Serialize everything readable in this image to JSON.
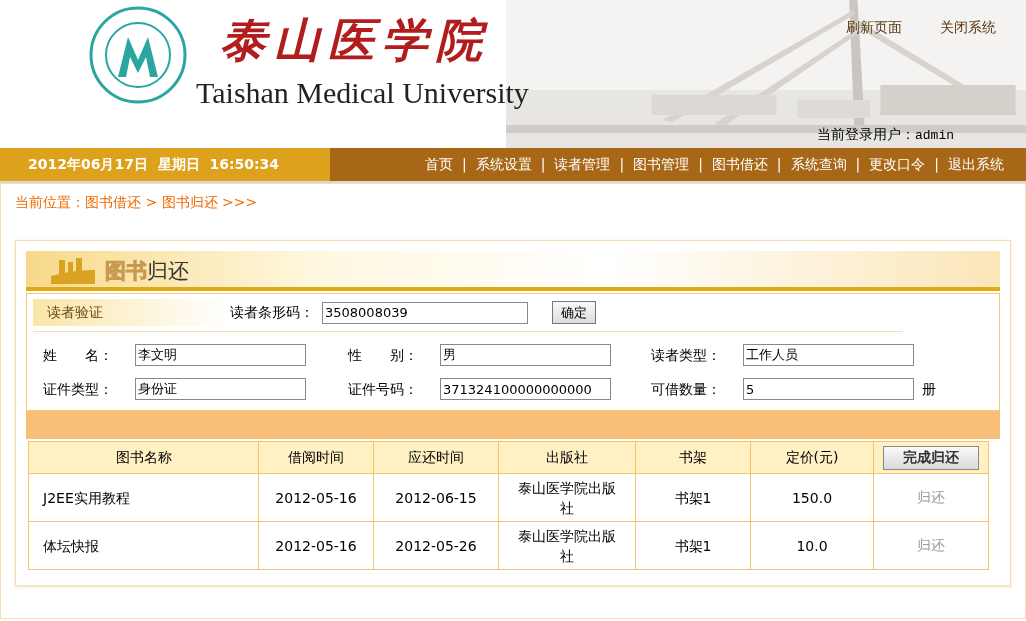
{
  "header": {
    "title": "泰山医学院",
    "subtitle": "Taishan Medical University",
    "links": [
      "刷新页面",
      "关闭系统"
    ],
    "user_label": "当前登录用户：",
    "user": "admin"
  },
  "nav": {
    "datetime": "2012年06月17日  星期日  16:50:34",
    "items": [
      "首页",
      "系统设置",
      "读者管理",
      "图书管理",
      "图书借还",
      "系统查询",
      "更改口令",
      "退出系统"
    ],
    "separator": "|"
  },
  "breadcrumb": "当前位置：图书借还 > 图书归还 >>>",
  "panel": {
    "title_parts": [
      "图书",
      "归还"
    ],
    "verify": {
      "label": "读者验证",
      "field_label": "读者条形码：",
      "value": "3508008039",
      "button": "确定"
    },
    "fields": [
      {
        "label": "姓　　名：",
        "value": "李文明"
      },
      {
        "label": "性　　别：",
        "value": "男"
      },
      {
        "label": "读者类型：",
        "value": "工作人员"
      },
      {
        "label": "证件类型：",
        "value": "身份证"
      },
      {
        "label": "证件号码：",
        "value": "371324100000000000"
      },
      {
        "label": "可借数量：",
        "value": "5",
        "unit": "册"
      }
    ],
    "table": {
      "columns": [
        "图书名称",
        "借阅时间",
        "应还时间",
        "出版社",
        "书架",
        "定价(元)"
      ],
      "action_button": "完成归还",
      "rows": [
        {
          "cells": [
            "J2EE实用教程",
            "2012-05-16",
            "2012-06-15",
            "泰山医学院出版社",
            "书架1",
            "150.0"
          ],
          "action": "归还"
        },
        {
          "cells": [
            "体坛快报",
            "2012-05-16",
            "2012-05-26",
            "泰山医学院出版社",
            "书架1",
            "10.0"
          ],
          "action": "归还"
        }
      ]
    }
  }
}
